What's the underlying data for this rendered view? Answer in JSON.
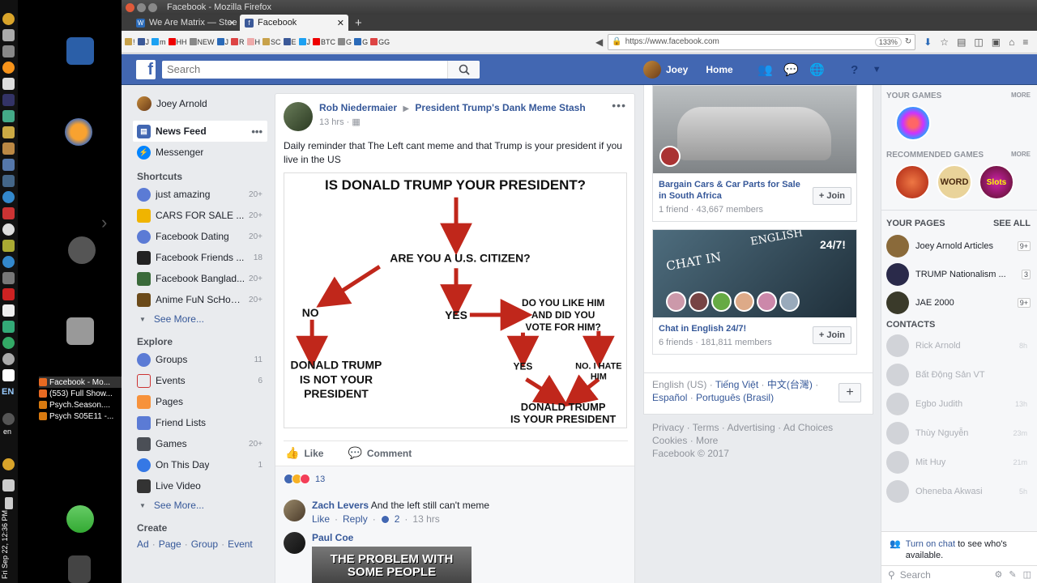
{
  "window": {
    "title": "Facebook - Mozilla Firefox"
  },
  "tabs": [
    {
      "label": "We Are Matrix — Stee",
      "fav": "W"
    },
    {
      "label": "Facebook",
      "fav": "f"
    }
  ],
  "bookmarks": [
    "!",
    "J",
    "m",
    "HH",
    "NEW",
    "J",
    "R",
    "H",
    "SC",
    "E",
    "J",
    "BTC",
    "G",
    "G",
    "GG"
  ],
  "urlbar": {
    "url": "https://www.facebook.com",
    "zoom": "133%"
  },
  "taskbar": {
    "items": [
      "Facebook - Mo...",
      "(553) Full Show...",
      "Psych.Season....",
      "Psych S05E11 -..."
    ],
    "lang": "EN",
    "lang2": "en",
    "clock": "Fri Sep 22, 12:36 PM"
  },
  "header": {
    "search_placeholder": "Search",
    "user": "Joey",
    "home": "Home"
  },
  "leftnav": {
    "profile": "Joey Arnold",
    "news_feed": "News Feed",
    "messenger": "Messenger",
    "shortcuts_title": "Shortcuts",
    "shortcuts": [
      {
        "label": "just amazing",
        "count": "20+"
      },
      {
        "label": "CARS FOR SALE ...",
        "count": "20+"
      },
      {
        "label": "Facebook Dating",
        "count": "20+"
      },
      {
        "label": "Facebook Friends ...",
        "count": "18"
      },
      {
        "label": "Facebook Banglad...",
        "count": "20+"
      },
      {
        "label": "Anime FuN ScHoO...",
        "count": "20+"
      }
    ],
    "see_more": "See More...",
    "explore_title": "Explore",
    "explore": [
      {
        "label": "Groups",
        "count": "11"
      },
      {
        "label": "Events",
        "count": "6"
      },
      {
        "label": "Pages",
        "count": ""
      },
      {
        "label": "Friend Lists",
        "count": ""
      },
      {
        "label": "Games",
        "count": "20+"
      },
      {
        "label": "On This Day",
        "count": "1"
      },
      {
        "label": "Live Video",
        "count": ""
      }
    ],
    "see_more2": "See More...",
    "create_title": "Create",
    "create": [
      "Ad",
      "Page",
      "Group",
      "Event"
    ]
  },
  "post": {
    "author": "Rob Niedermaier",
    "target": "President Trump's Dank Meme Stash",
    "time": "13 hrs",
    "text": "Daily reminder that The Left cant meme and that Trump is your president if you live in the US",
    "meme": {
      "q1": "IS DONALD TRUMP YOUR PRESIDENT?",
      "q2": "ARE YOU A U.S. CITIZEN?",
      "no": "NO",
      "yes": "YES",
      "q3a": "DO YOU LIKE HIM",
      "q3b": "AND DID YOU",
      "q3c": "VOTE FOR HIM?",
      "not1": "DONALD TRUMP",
      "not2": "IS NOT YOUR",
      "not3": "PRESIDENT",
      "yes2": "YES",
      "hate1": "NO. I HATE",
      "hate2": "HIM",
      "is1": "DONALD TRUMP",
      "is2": "IS YOUR PRESIDENT"
    },
    "like": "Like",
    "comment": "Comment",
    "reactions": "13",
    "comments": [
      {
        "name": "Zach Levers",
        "text": "And the left still can't meme",
        "like": "Like",
        "reply": "Reply",
        "likes": "2",
        "time": "13 hrs"
      },
      {
        "name": "Paul Coe",
        "image_text": "THE PROBLEM WITH SOME PEOPLE"
      }
    ]
  },
  "groups": [
    {
      "name": "Bargain Cars & Car Parts for Sale in South Africa",
      "meta": "1 friend · 43,667 members",
      "join": "Join"
    },
    {
      "name": "Chat in English 24/7!",
      "meta": "6 friends · 181,811 members",
      "join": "Join",
      "img_a": "CHAT IN",
      "img_b": "ENGLISH",
      "img_c": "24/7!"
    }
  ],
  "footer": {
    "lang1": "English (US)",
    "lang2": "Tiếng Việt",
    "lang3": "中文(台灣)",
    "lang4": "Español",
    "lang5": "Português (Brasil)",
    "links1": "Privacy · Terms · Advertising · Ad Choices",
    "links2": "Cookies · More",
    "copy": "Facebook © 2017"
  },
  "rail": {
    "your_games": "YOUR GAMES",
    "more": "MORE",
    "rec_games": "RECOMMENDED GAMES",
    "more2": "MORE",
    "game_label": "WORD",
    "slots_label": "Slots",
    "your_pages": "YOUR PAGES",
    "see_all": "SEE ALL",
    "pages": [
      {
        "name": "Joey Arnold Articles",
        "badge": "9+"
      },
      {
        "name": "TRUMP Nationalism ...",
        "badge": "3"
      },
      {
        "name": "JAE 2000",
        "badge": "9+"
      }
    ],
    "contacts_title": "CONTACTS",
    "contacts": [
      {
        "name": "Rick Arnold",
        "time": "8h"
      },
      {
        "name": "Bất Động Sản VT",
        "time": ""
      },
      {
        "name": "Egbo Judith",
        "time": "13h"
      },
      {
        "name": "Thùy Nguyễn",
        "time": "23m"
      },
      {
        "name": "Mit Huy",
        "time": "21m"
      },
      {
        "name": "Oheneba Akwasi",
        "time": "5h"
      }
    ],
    "chat_link": "Turn on chat",
    "chat_rest": " to see who's available.",
    "chat_search": "Search"
  },
  "colors": {
    "fb_blue": "#4267b2",
    "link": "#365899",
    "meme_arrow": "#c0271b"
  }
}
